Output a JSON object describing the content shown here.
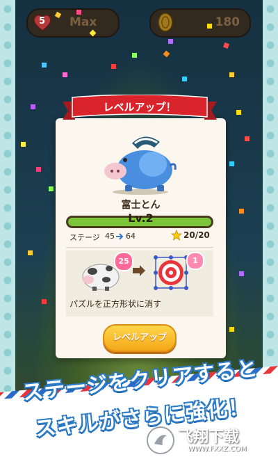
{
  "hud": {
    "lives": "5",
    "lives_label": "Max",
    "coins": "180"
  },
  "ribbon_title": "レベルアップ！",
  "character": {
    "name": "富士とん",
    "level": "Lv.2",
    "level_progress": 1.0
  },
  "stage": {
    "label": "ステージ",
    "from": "45",
    "to": "64"
  },
  "stars": {
    "count": "20/20"
  },
  "skill": {
    "before_badge": "25",
    "after_badge": "1",
    "description": "パズルを正方形状に消す"
  },
  "button": {
    "levelup": "レベルアップ"
  },
  "banner": {
    "line1": "ステージをクリアすると",
    "line2": "スキルがさらに強化！"
  },
  "watermark": {
    "text": "飞翔下载",
    "url": "WWW.FXXZ.COM"
  },
  "colors": {
    "ribbon": "#d8242a",
    "bar_fill": "#7cc43a",
    "button": "#f4a818",
    "banner_text_outline": "#2a7ac8"
  }
}
